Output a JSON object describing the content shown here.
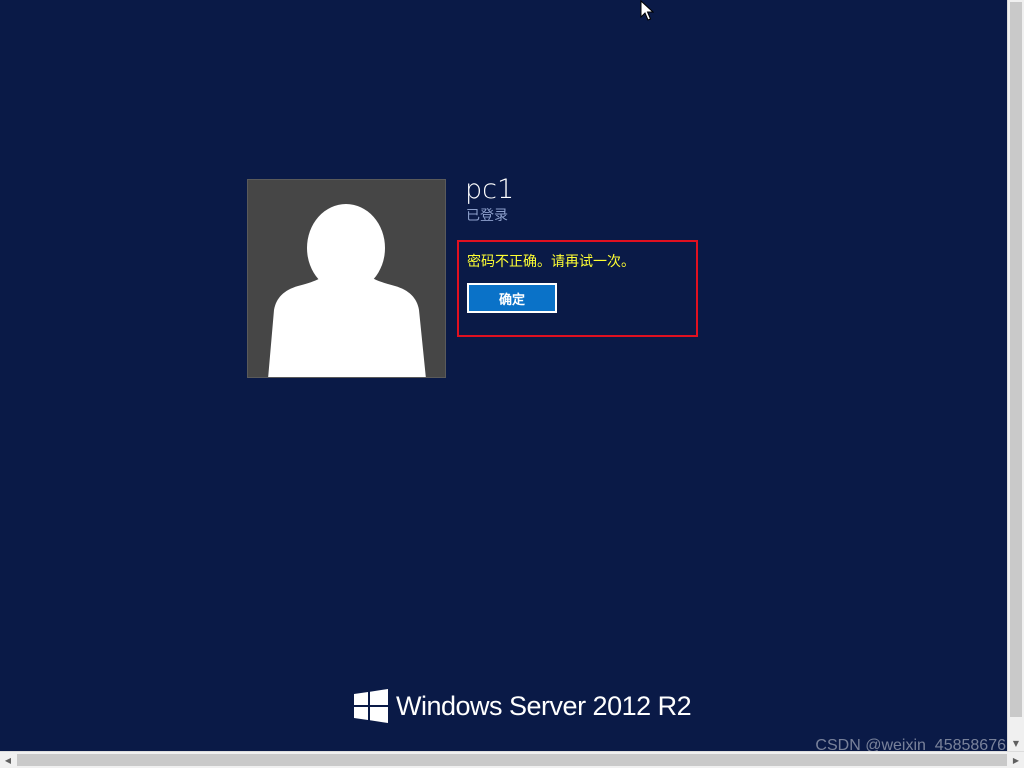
{
  "login": {
    "username": "pc1",
    "status": "已登录",
    "error_message": "密码不正确。请再试一次。",
    "ok_label": "确定"
  },
  "branding": {
    "product": "Windows Server 2012 R2",
    "logo_icon": "windows-logo-icon"
  },
  "watermark": "CSDN @weixin_45858676",
  "colors": {
    "background": "#0a1a47",
    "avatar_tile": "#464646",
    "error_text": "#ffff33",
    "error_highlight": "#e01020",
    "button": "#0a72c8",
    "status_text": "#8da0cc"
  },
  "icons": {
    "avatar": "user-avatar-icon",
    "cursor": "mouse-pointer-icon"
  }
}
